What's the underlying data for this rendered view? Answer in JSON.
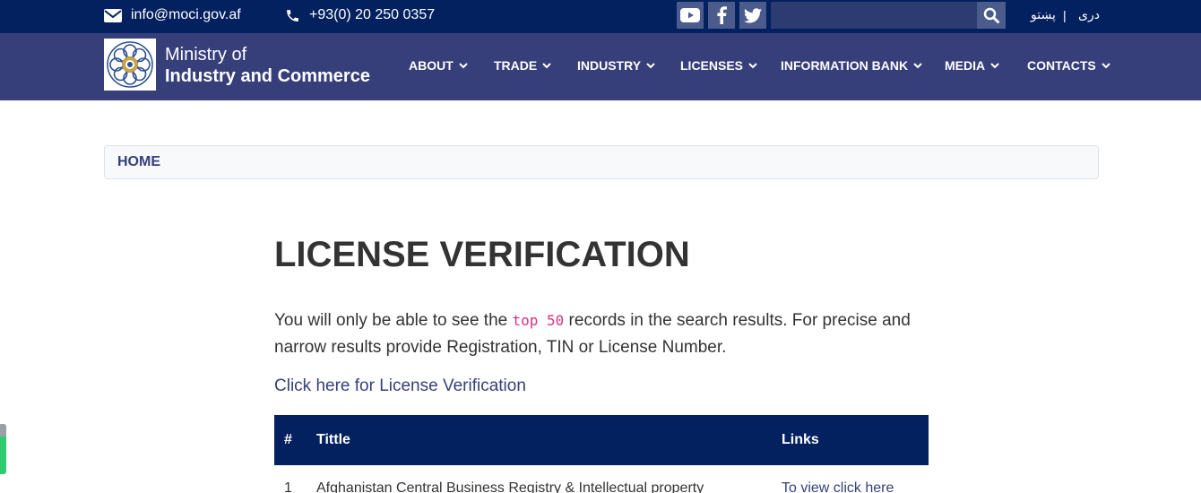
{
  "topbar": {
    "email": "info@moci.gov.af",
    "phone": "+93(0) 20 250 0357",
    "social": [
      "youtube-icon",
      "facebook-icon",
      "twitter-icon"
    ],
    "search_placeholder": "",
    "lang_pashto": "پښتو",
    "lang_separator": "|",
    "lang_dari": "دری"
  },
  "nav": {
    "brand_line1": "Ministry of",
    "brand_line2": "Industry and Commerce",
    "items": [
      {
        "label": "ABOUT"
      },
      {
        "label": "TRADE"
      },
      {
        "label": "INDUSTRY"
      },
      {
        "label": "LICENSES"
      },
      {
        "label": "INFORMATION BANK"
      },
      {
        "label": "MEDIA"
      },
      {
        "label": "CONTACTS"
      }
    ]
  },
  "breadcrumb": {
    "home": "HOME"
  },
  "main": {
    "title": "LICENSE VERIFICATION",
    "intro_before": "You will only be able to see the ",
    "intro_code": "top 50",
    "intro_after": " records in the search results. For precise and narrow results provide Registration, TIN or License Number.",
    "link_text": "Click here for License Verification",
    "table": {
      "headers": {
        "num": "#",
        "title": "Tittle",
        "links": "Links"
      },
      "rows": [
        {
          "num": "1",
          "title": "Afghanistan Central Business Registry & Intellectual property",
          "link": "To view click here"
        }
      ]
    }
  },
  "colors": {
    "topbar_bg": "#03215f",
    "navbar_bg": "#363f7a",
    "table_header_bg": "#03215f",
    "link": "#363f7a",
    "code": "#d63384"
  }
}
